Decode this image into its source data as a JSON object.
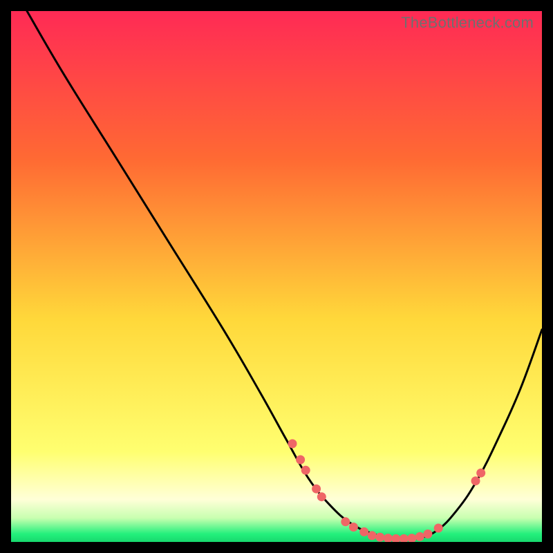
{
  "watermark": "TheBottleneck.com",
  "colors": {
    "gradient_top": "#ff2a55",
    "gradient_mid1": "#ff8a2a",
    "gradient_mid2": "#ffe938",
    "gradient_pale": "#ffffc0",
    "gradient_green": "#23f07c",
    "curve": "#000000",
    "dots": "#ef6666",
    "frame_bg": "#000000"
  },
  "chart_data": {
    "type": "line",
    "title": "",
    "xlabel": "",
    "ylabel": "",
    "xlim": [
      0,
      100
    ],
    "ylim": [
      0,
      100
    ],
    "series": [
      {
        "name": "bottleneck-curve",
        "x": [
          3,
          10,
          20,
          30,
          40,
          47,
          52,
          56,
          60,
          64,
          68,
          72,
          76,
          80,
          84,
          88,
          92,
          96,
          100
        ],
        "y": [
          100,
          88,
          72,
          56,
          40,
          28,
          19,
          12,
          7,
          3.5,
          1.6,
          0.6,
          0.6,
          2.0,
          6,
          12,
          20,
          29,
          40
        ]
      }
    ],
    "points": [
      {
        "name": "dot",
        "x": 53,
        "y": 18.5
      },
      {
        "name": "dot",
        "x": 54.5,
        "y": 15.5
      },
      {
        "name": "dot",
        "x": 55.5,
        "y": 13.5
      },
      {
        "name": "dot",
        "x": 57.5,
        "y": 10.0
      },
      {
        "name": "dot",
        "x": 58.5,
        "y": 8.5
      },
      {
        "name": "dot",
        "x": 63.0,
        "y": 3.8
      },
      {
        "name": "dot",
        "x": 64.5,
        "y": 2.8
      },
      {
        "name": "dot",
        "x": 66.5,
        "y": 1.9
      },
      {
        "name": "dot",
        "x": 68.0,
        "y": 1.2
      },
      {
        "name": "dot",
        "x": 69.5,
        "y": 0.9
      },
      {
        "name": "dot",
        "x": 71.0,
        "y": 0.7
      },
      {
        "name": "dot",
        "x": 72.5,
        "y": 0.6
      },
      {
        "name": "dot",
        "x": 74.0,
        "y": 0.6
      },
      {
        "name": "dot",
        "x": 75.5,
        "y": 0.7
      },
      {
        "name": "dot",
        "x": 77.0,
        "y": 1.0
      },
      {
        "name": "dot",
        "x": 78.5,
        "y": 1.5
      },
      {
        "name": "dot",
        "x": 80.5,
        "y": 2.6
      },
      {
        "name": "dot",
        "x": 87.5,
        "y": 11.5
      },
      {
        "name": "dot",
        "x": 88.5,
        "y": 13.0
      }
    ],
    "legend": false,
    "grid": false
  }
}
